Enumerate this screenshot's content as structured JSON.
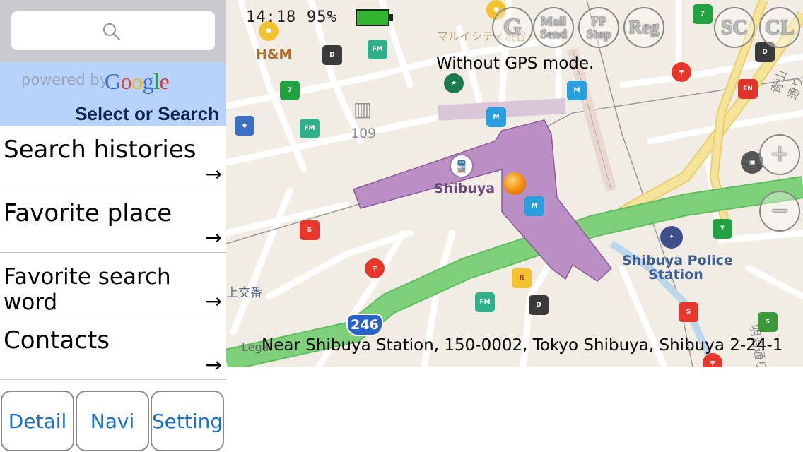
{
  "search": {
    "icon": "search-icon"
  },
  "google_bar": {
    "powered_by": "powered by",
    "google_letters": [
      {
        "ch": "G",
        "color": "#3b6fe0"
      },
      {
        "ch": "o",
        "color": "#e03b2b"
      },
      {
        "ch": "o",
        "color": "#f3b400"
      },
      {
        "ch": "g",
        "color": "#3b6fe0"
      },
      {
        "ch": "l",
        "color": "#1e9e3c"
      },
      {
        "ch": "e",
        "color": "#e03b2b"
      }
    ],
    "select_label": "Select or Search"
  },
  "menu": {
    "items": [
      {
        "label": "Search histories",
        "arrow": "→"
      },
      {
        "label": "Favorite place",
        "arrow": "→"
      },
      {
        "label": "Favorite search word",
        "arrow": "→"
      },
      {
        "label": "Contacts",
        "arrow": "→"
      }
    ]
  },
  "buttons": {
    "detail": "Detail",
    "navi": "Navi",
    "setting": "Setting"
  },
  "status": {
    "time": "14:18",
    "battery_pct": "95%",
    "battery_color": "#31b531"
  },
  "map": {
    "gps_mode": "Without GPS mode.",
    "address": "Near Shibuya Station, 150-0002, Tokyo Shibuya, Shibuya 2-24-1",
    "legal": "Legal",
    "labels": {
      "hm": "H&M",
      "marui": "マルイシティ渋谷",
      "shibuya": "Shibuya",
      "num109": "109",
      "police": "Shibuya Police",
      "station": "Station",
      "kamikoban": "上交番",
      "route": "246",
      "aoyama": "青山通り",
      "meiji": "明治通り"
    },
    "controls": {
      "g": "G",
      "mail": "Mail",
      "send": "Send",
      "fp": "FP",
      "stop": "Stop",
      "reg": "Reg",
      "sc": "SC",
      "cl": "CL",
      "zoom_in": "+",
      "zoom_out": "−"
    },
    "station_color": "#b98fc6",
    "road_green": "#7fd07a",
    "road_yellow": "#f6e39a"
  }
}
